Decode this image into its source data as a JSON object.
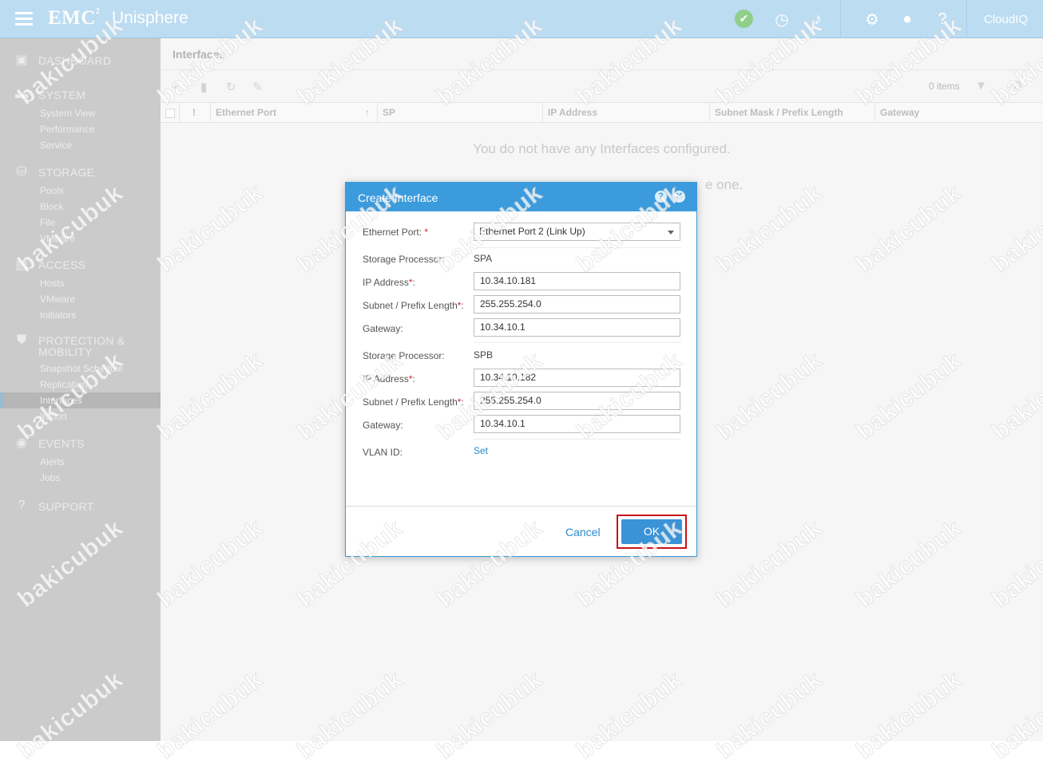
{
  "topbar": {
    "brand": "EMC",
    "brand_sup": "2",
    "product": "Unisphere",
    "cloudiq": "CloudIQ",
    "icons": [
      "menu-icon",
      "health-ok-icon",
      "clock-icon",
      "bell-icon",
      "gear-icon",
      "user-icon",
      "help-icon",
      "cloudiq-icon"
    ]
  },
  "sidebar": {
    "sections": [
      {
        "label": "DASHBOARD",
        "icon": "dashboard-icon",
        "items": []
      },
      {
        "label": "SYSTEM",
        "icon": "system-icon",
        "items": [
          "System View",
          "Performance",
          "Service"
        ]
      },
      {
        "label": "STORAGE",
        "icon": "storage-icon",
        "items": [
          "Pools",
          "Block",
          "File",
          "VMware"
        ]
      },
      {
        "label": "ACCESS",
        "icon": "access-icon",
        "items": [
          "Hosts",
          "VMware",
          "Initiators"
        ]
      },
      {
        "label": "PROTECTION &",
        "label2": "MOBILITY",
        "icon": "shield-icon",
        "items": [
          "Snapshot Schedule",
          "Replication",
          "Interfaces",
          "Import"
        ]
      },
      {
        "label": "EVENTS",
        "icon": "events-icon",
        "items": [
          "Alerts",
          "Jobs"
        ]
      },
      {
        "label": "SUPPORT",
        "icon": "support-icon",
        "items": []
      }
    ],
    "active_item": "Interfaces"
  },
  "main": {
    "title": "Interfaces",
    "item_count": "0 items",
    "columns": [
      "!",
      "Ethernet Port",
      "SP",
      "IP Address",
      "Subnet Mask / Prefix Length",
      "Gateway"
    ],
    "empty_message": "You do not have any Interfaces configured.",
    "empty_hint_tail": "e one."
  },
  "dialog": {
    "title": "Create Interface",
    "ethernet_port_label": "Ethernet Port:",
    "ethernet_port_value": "Ethernet Port 2 (Link Up)",
    "spa": {
      "sp_label": "Storage Processor:",
      "sp_value": "SPA",
      "ip_label": "IP Address",
      "ip_value": "10.34.10.181",
      "subnet_label": "Subnet / Prefix Length",
      "subnet_value": "255.255.254.0",
      "gateway_label": "Gateway:",
      "gateway_value": "10.34.10.1"
    },
    "spb": {
      "sp_label": "Storage Processor:",
      "sp_value": "SPB",
      "ip_label": "IP Address",
      "ip_value": "10.34.10.182",
      "subnet_label": "Subnet / Prefix Length",
      "subnet_value": "255.255.254.0",
      "gateway_label": "Gateway:",
      "gateway_value": "10.34.10.1"
    },
    "vlan_label": "VLAN ID:",
    "vlan_link": "Set",
    "required_mark": "*",
    "colon": ":",
    "cancel_label": "Cancel",
    "ok_label": "OK"
  },
  "watermark": "bakicubuk",
  "colors": {
    "topbar": "#bcdcf1",
    "sidebar": "#cbcbcb",
    "dialog_header": "#3c9bdc",
    "ok_button": "#3a93d6",
    "highlight": "#c8141a"
  }
}
